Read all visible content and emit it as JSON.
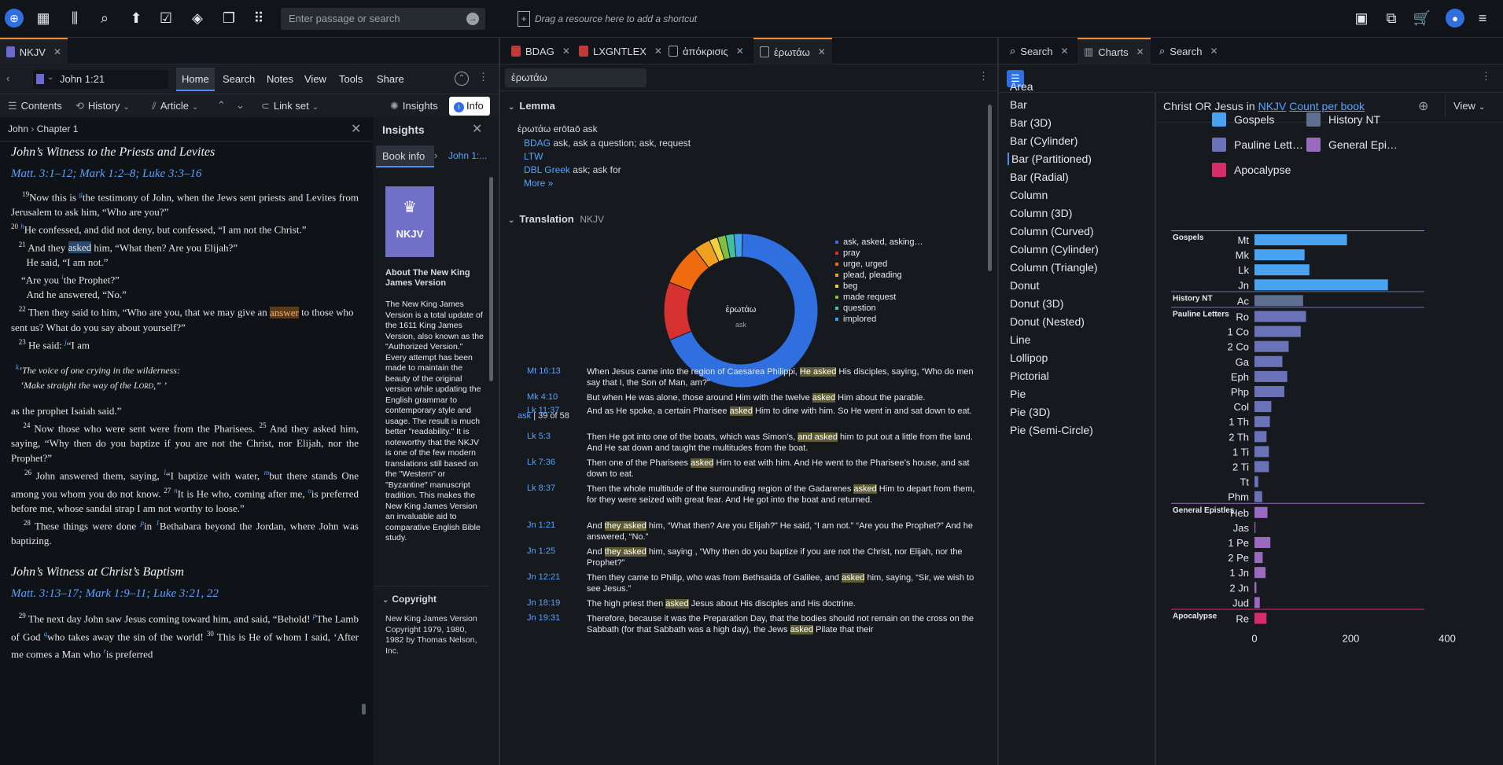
{
  "top": {
    "search_placeholder": "Enter passage or search",
    "shortcut_hint": "Drag a resource here to add a shortcut"
  },
  "tabs_left": [
    {
      "label": "NKJV"
    }
  ],
  "tabs_mid": [
    {
      "label": "BDAG"
    },
    {
      "label": "LXGNTLEX"
    },
    {
      "label": "ἀπόκρισις"
    },
    {
      "label": "ἐρωτάω"
    }
  ],
  "tabs_right": [
    {
      "label": "Search"
    },
    {
      "label": "Charts"
    },
    {
      "label": "Search"
    }
  ],
  "left": {
    "reference": "John 1:21",
    "menu": [
      "Home",
      "Search",
      "Notes",
      "View",
      "Tools",
      "Share"
    ],
    "toolbar": {
      "contents": "Contents",
      "history": "History",
      "article": "Article",
      "linkset": "Link set",
      "insights": "Insights",
      "info": "Info"
    },
    "breadcrumb_book": "John",
    "breadcrumb_chapter": "Chapter 1",
    "heading1": "John’s Witness to the Priests and Levites",
    "xref1": "Matt. 3:1–12; Mark 1:2–8; Luke 3:3–16",
    "heading2": "John’s Witness at Christ’s Baptism",
    "xref2": "Matt. 3:13–17; Mark 1:9–11; Luke 3:21, 22"
  },
  "insights": {
    "title": "Insights",
    "tab_bookinfo": "Book info",
    "tab_ref": "John 1:...",
    "book_abbrev": "NKJV",
    "about_title": "About The New King James Version",
    "about_text": "The New King James Version is a total update of the 1611 King James Version, also known as the \"Authorized Version.\" Every attempt has been made to maintain the beauty of the original version while updating the English grammar to contemporary style and usage. The result is much better \"readability.\" It is noteworthy that the NKJV is one of the few modern translations still based on the \"Western\" or \"Byzantine\" manuscript tradition. This makes the New King James Version an invaluable aid to comparative English Bible study.",
    "copyright_title": "Copyright",
    "copyright_text": "New King James Version Copyright 1979, 1980, 1982 by Thomas Nelson, Inc."
  },
  "mid": {
    "query": "ἐρωτάω",
    "lemma_title": "Lemma",
    "lemma_line": "ἐρωτάω erōtaō ask",
    "lemma_entries": [
      {
        "src": "BDAG",
        "text": "ask, ask a question; ask, request"
      },
      {
        "src": "LTW",
        "text": ""
      },
      {
        "src": "DBL Greek",
        "text": "ask; ask for"
      }
    ],
    "more": "More »",
    "translation_title": "Translation",
    "translation_version": "NKJV",
    "donut_center_word": "ἐρωτάω",
    "donut_center_sub": "ask",
    "legend": [
      {
        "label": "ask, asked, asking…",
        "color": "#2f6fe0",
        "value": 39
      },
      {
        "label": "pray",
        "color": "#d63030",
        "value": 7
      },
      {
        "label": "urge, urged",
        "color": "#f06a10",
        "value": 5
      },
      {
        "label": "plead, pleading",
        "color": "#f0a020",
        "value": 2
      },
      {
        "label": "beg",
        "color": "#f0d040",
        "value": 1
      },
      {
        "label": "made request",
        "color": "#80c040",
        "value": 1
      },
      {
        "label": "question",
        "color": "#40c0a0",
        "value": 1
      },
      {
        "label": "implored",
        "color": "#40a0f0",
        "value": 1
      }
    ],
    "count_word": "ask",
    "count_text": "| 39 of 58",
    "results": [
      {
        "ref": "Mt 16:13",
        "text": "When Jesus came into the region of Caesarea Philippi, He asked His disciples, saying, “Who do men say that I, the Son of Man, am?”"
      },
      {
        "ref": "Mk 4:10",
        "text": "But when He was alone, those around Him with the twelve asked Him about the parable."
      },
      {
        "ref": "Lk 11:37",
        "text": "And as He spoke, a certain Pharisee asked Him to dine with him. So He went in and sat down to eat."
      },
      {
        "ref": "Lk 5:3",
        "text": "Then He got into one of the boats, which was Simon’s, and asked him to put out a little from the land. And He sat down and taught the multitudes from the boat."
      },
      {
        "ref": "Lk 7:36",
        "text": "Then one of the Pharisees asked Him to eat with him. And He went to the Pharisee’s house, and sat down to eat."
      },
      {
        "ref": "Lk 8:37",
        "text": "Then the whole multitude of the surrounding region of the Gadarenes asked Him to depart from them, for they were seized with great fear. And He got into the boat and returned."
      },
      {
        "ref": "Jn 1:21",
        "text": "And they asked him, “What then? Are you Elijah?” He said, “I am not.” “Are you the Prophet?” And he answered, “No.”"
      },
      {
        "ref": "Jn 1:25",
        "text": "And they asked him, saying , “Why then do you baptize if you are not the Christ, nor Elijah, nor the Prophet?”"
      },
      {
        "ref": "Jn 12:21",
        "text": "Then they came to Philip, who was from Bethsaida of Galilee, and asked him, saying, “Sir, we wish to see Jesus.”"
      },
      {
        "ref": "Jn 18:19",
        "text": "The high priest then asked Jesus about His disciples and His doctrine."
      },
      {
        "ref": "Jn 19:31",
        "text": "Therefore, because it was the Preparation Day, that the bodies should not remain on the cross on the Sabbath (for that Sabbath was a high day), the Jews asked Pilate that their"
      }
    ]
  },
  "charts_list": [
    "Area",
    "Bar",
    "Bar (3D)",
    "Bar (Cylinder)",
    "Bar (Partitioned)",
    "Bar (Radial)",
    "Column",
    "Column (3D)",
    "Column (Curved)",
    "Column (Cylinder)",
    "Column (Triangle)",
    "Donut",
    "Donut (3D)",
    "Donut (Nested)",
    "Line",
    "Lollipop",
    "Pictorial",
    "Pie",
    "Pie (3D)",
    "Pie (Semi-Circle)"
  ],
  "chart_header": {
    "query": "Christ OR Jesus in",
    "version": "NKJV",
    "mode": "Count per book",
    "view": "View"
  },
  "chart_data": {
    "type": "bar",
    "legend": [
      {
        "name": "Gospels",
        "color": "#4aa3f0"
      },
      {
        "name": "History NT",
        "color": "#5f6f8f"
      },
      {
        "name": "Pauline Lett…",
        "color": "#6a72b8"
      },
      {
        "name": "General Epi…",
        "color": "#9a6ac0"
      },
      {
        "name": "Apocalypse",
        "color": "#d82c6a"
      }
    ],
    "groups": [
      {
        "name": "Gospels",
        "color": "#4aa3f0",
        "rows": [
          {
            "label": "Mt",
            "value": 192
          },
          {
            "label": "Mk",
            "value": 104
          },
          {
            "label": "Lk",
            "value": 114
          },
          {
            "label": "Jn",
            "value": 277
          }
        ]
      },
      {
        "name": "History NT",
        "color": "#5f6f8f",
        "rows": [
          {
            "label": "Ac",
            "value": 101
          }
        ]
      },
      {
        "name": "Pauline Letters",
        "color": "#6a72b8",
        "rows": [
          {
            "label": "Ro",
            "value": 107
          },
          {
            "label": "1 Co",
            "value": 96
          },
          {
            "label": "2 Co",
            "value": 71
          },
          {
            "label": "Ga",
            "value": 58
          },
          {
            "label": "Eph",
            "value": 68
          },
          {
            "label": "Php",
            "value": 62
          },
          {
            "label": "Col",
            "value": 35
          },
          {
            "label": "1 Th",
            "value": 32
          },
          {
            "label": "2 Th",
            "value": 25
          },
          {
            "label": "1 Ti",
            "value": 30
          },
          {
            "label": "2 Ti",
            "value": 30
          },
          {
            "label": "Tt",
            "value": 8
          },
          {
            "label": "Phm",
            "value": 16
          }
        ]
      },
      {
        "name": "General Epistles",
        "color": "#9a6ac0",
        "rows": [
          {
            "label": "Heb",
            "value": 27
          },
          {
            "label": "Jas",
            "value": 2
          },
          {
            "label": "1 Pe",
            "value": 33
          },
          {
            "label": "2 Pe",
            "value": 17
          },
          {
            "label": "1 Jn",
            "value": 23
          },
          {
            "label": "2 Jn",
            "value": 4
          },
          {
            "label": "Jud",
            "value": 11
          }
        ]
      },
      {
        "name": "Apocalypse",
        "color": "#d82c6a",
        "rows": [
          {
            "label": "Re",
            "value": 25
          }
        ]
      }
    ],
    "xticks": [
      "0",
      "200",
      "400"
    ],
    "xlim": [
      0,
      400
    ]
  }
}
